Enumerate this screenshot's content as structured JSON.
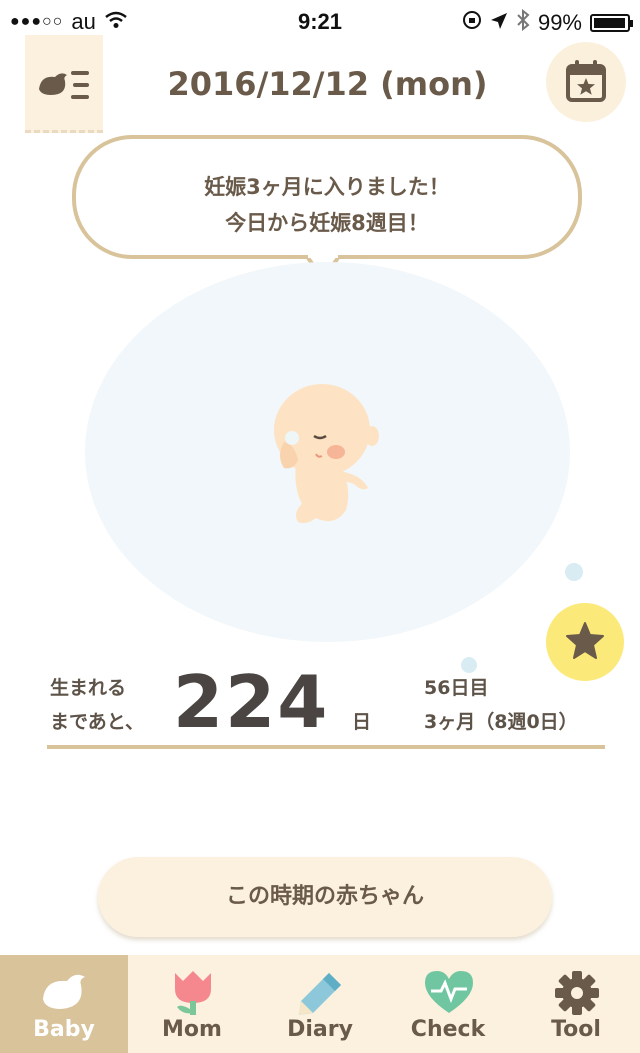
{
  "status_bar": {
    "signal": "●●●○○",
    "carrier": "au",
    "time": "9:21",
    "battery": "99%"
  },
  "header": {
    "date": "2016/12/12 (mon)",
    "menu_icon": "bird-list-icon",
    "calendar_icon": "calendar-star-icon"
  },
  "message": {
    "line1": "妊娠3ヶ月に入りました！",
    "line2": "今日から妊娠8週目！"
  },
  "countdown": {
    "label_line1": "生まれる",
    "label_line2": "まであと、",
    "days": "224",
    "unit": "日",
    "day_count": "56日目",
    "month_week": "3ヶ月（8週0日）"
  },
  "period_button": "この時期の赤ちゃん",
  "tabs": [
    {
      "label": "Baby",
      "icon": "bird-icon",
      "active": true
    },
    {
      "label": "Mom",
      "icon": "tulip-icon",
      "active": false
    },
    {
      "label": "Diary",
      "icon": "pencil-icon",
      "active": false
    },
    {
      "label": "Check",
      "icon": "heart-pulse-icon",
      "active": false
    },
    {
      "label": "Tool",
      "icon": "gear-icon",
      "active": false
    }
  ],
  "colors": {
    "accent": "#d8c39a",
    "cream": "#fbf1de",
    "text": "#6a5a4a",
    "star_button": "#fbe97a",
    "womb": "#f1f7fa"
  }
}
